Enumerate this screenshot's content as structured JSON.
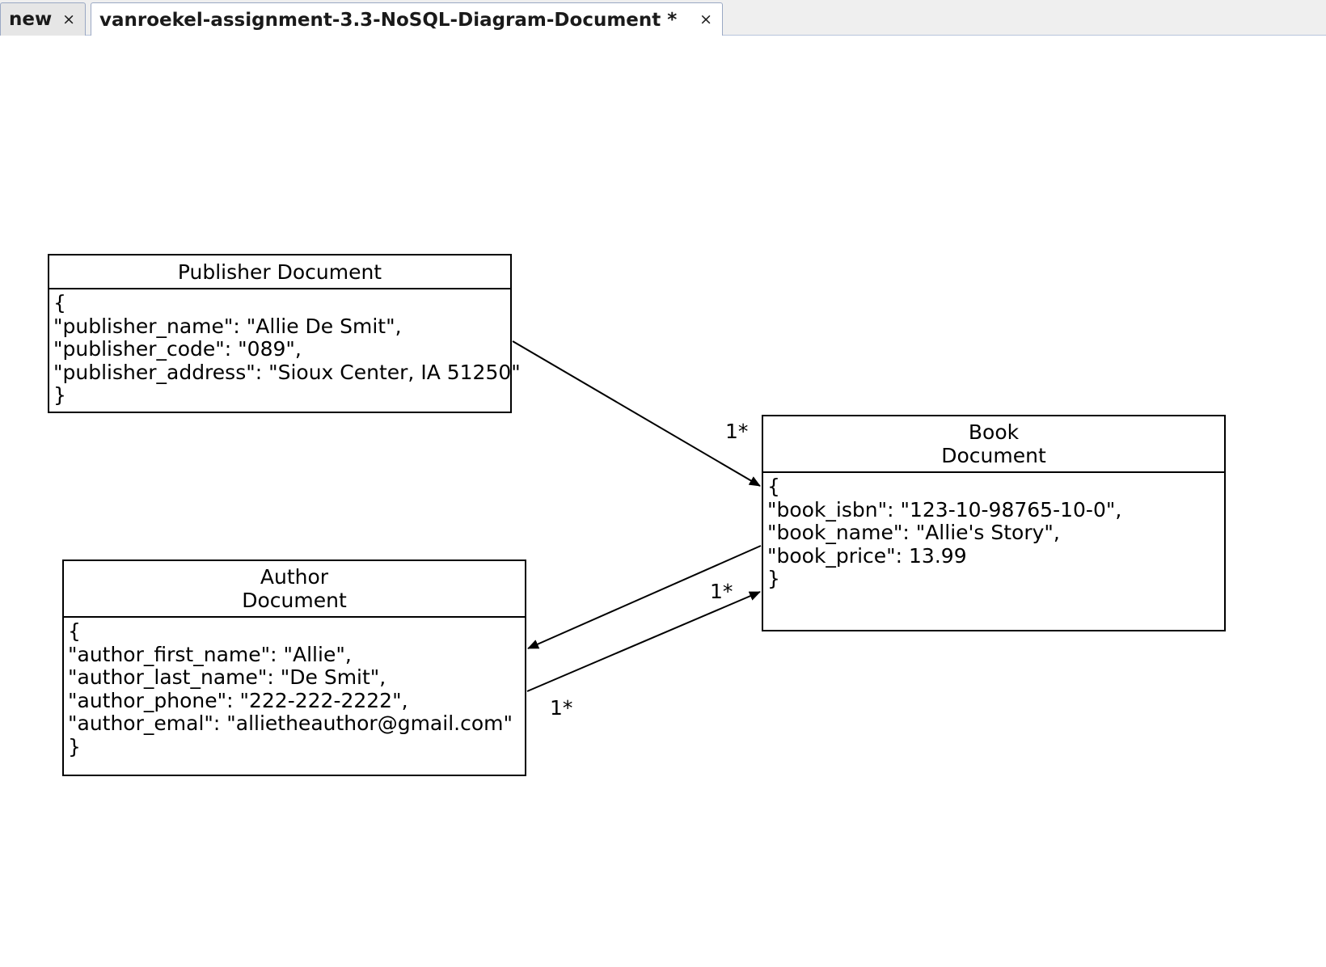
{
  "tabs": [
    {
      "label": "new",
      "close": "×"
    },
    {
      "label": "vanroekel-assignment-3.3-NoSQL-Diagram-Document *",
      "close": "×"
    }
  ],
  "diagram": {
    "publisher": {
      "title": "Publisher Document",
      "lines": [
        "{",
        "\"publisher_name\": \"Allie De Smit\",",
        "\"publisher_code\": \"089\",",
        "\"publisher_address\": \"Sioux Center, IA 51250\"",
        "}"
      ]
    },
    "book": {
      "title_line1": "Book",
      "title_line2": "Document",
      "lines": [
        "{",
        "\"book_isbn\": \"123-10-98765-10-0\",",
        "\"book_name\": \"Allie's Story\",",
        "\"book_price\": 13.99",
        "}"
      ]
    },
    "author": {
      "title_line1": "Author",
      "title_line2": "Document",
      "lines": [
        "{",
        "\"author_first_name\": \"Allie\",",
        "\"author_last_name\": \"De Smit\",",
        "\"author_phone\": \"222-222-2222\",",
        "\"author_emal\": \"allietheauthor@gmail.com\"",
        "}"
      ]
    },
    "multiplicities": {
      "publisher_to_book": "1*",
      "author_to_book_head": "1*",
      "author_to_book_tail": "1*"
    }
  }
}
